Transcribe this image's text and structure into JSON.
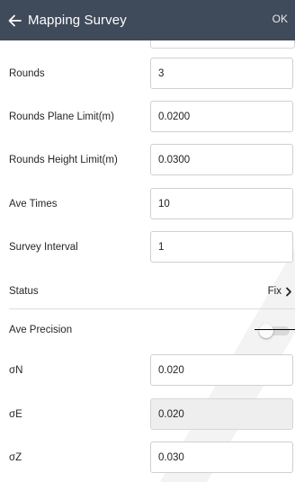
{
  "header": {
    "title": "Mapping Survey",
    "ok_label": "OK"
  },
  "form": {
    "rounds": {
      "label": "Rounds",
      "value": "3"
    },
    "rounds_plane_limit": {
      "label": "Rounds Plane Limit(m)",
      "value": "0.0200"
    },
    "rounds_height_limit": {
      "label": "Rounds Height Limit(m)",
      "value": "0.0300"
    },
    "ave_times": {
      "label": "Ave Times",
      "value": "10"
    },
    "survey_interval": {
      "label": "Survey Interval",
      "value": "1"
    },
    "status": {
      "label": "Status",
      "value": "Fix"
    },
    "ave_precision": {
      "label": "Ave Precision",
      "enabled": false
    },
    "sigma_n": {
      "label": "σN",
      "value": "0.020"
    },
    "sigma_e": {
      "label": "σE",
      "value": "0.020"
    },
    "sigma_z": {
      "label": "σZ",
      "value": "0.030"
    }
  },
  "colors": {
    "appbar": "#3f4a5a",
    "readonly_field": "#eeeeee"
  },
  "icons": [
    "arrow-left-icon",
    "chevron-right-icon"
  ]
}
